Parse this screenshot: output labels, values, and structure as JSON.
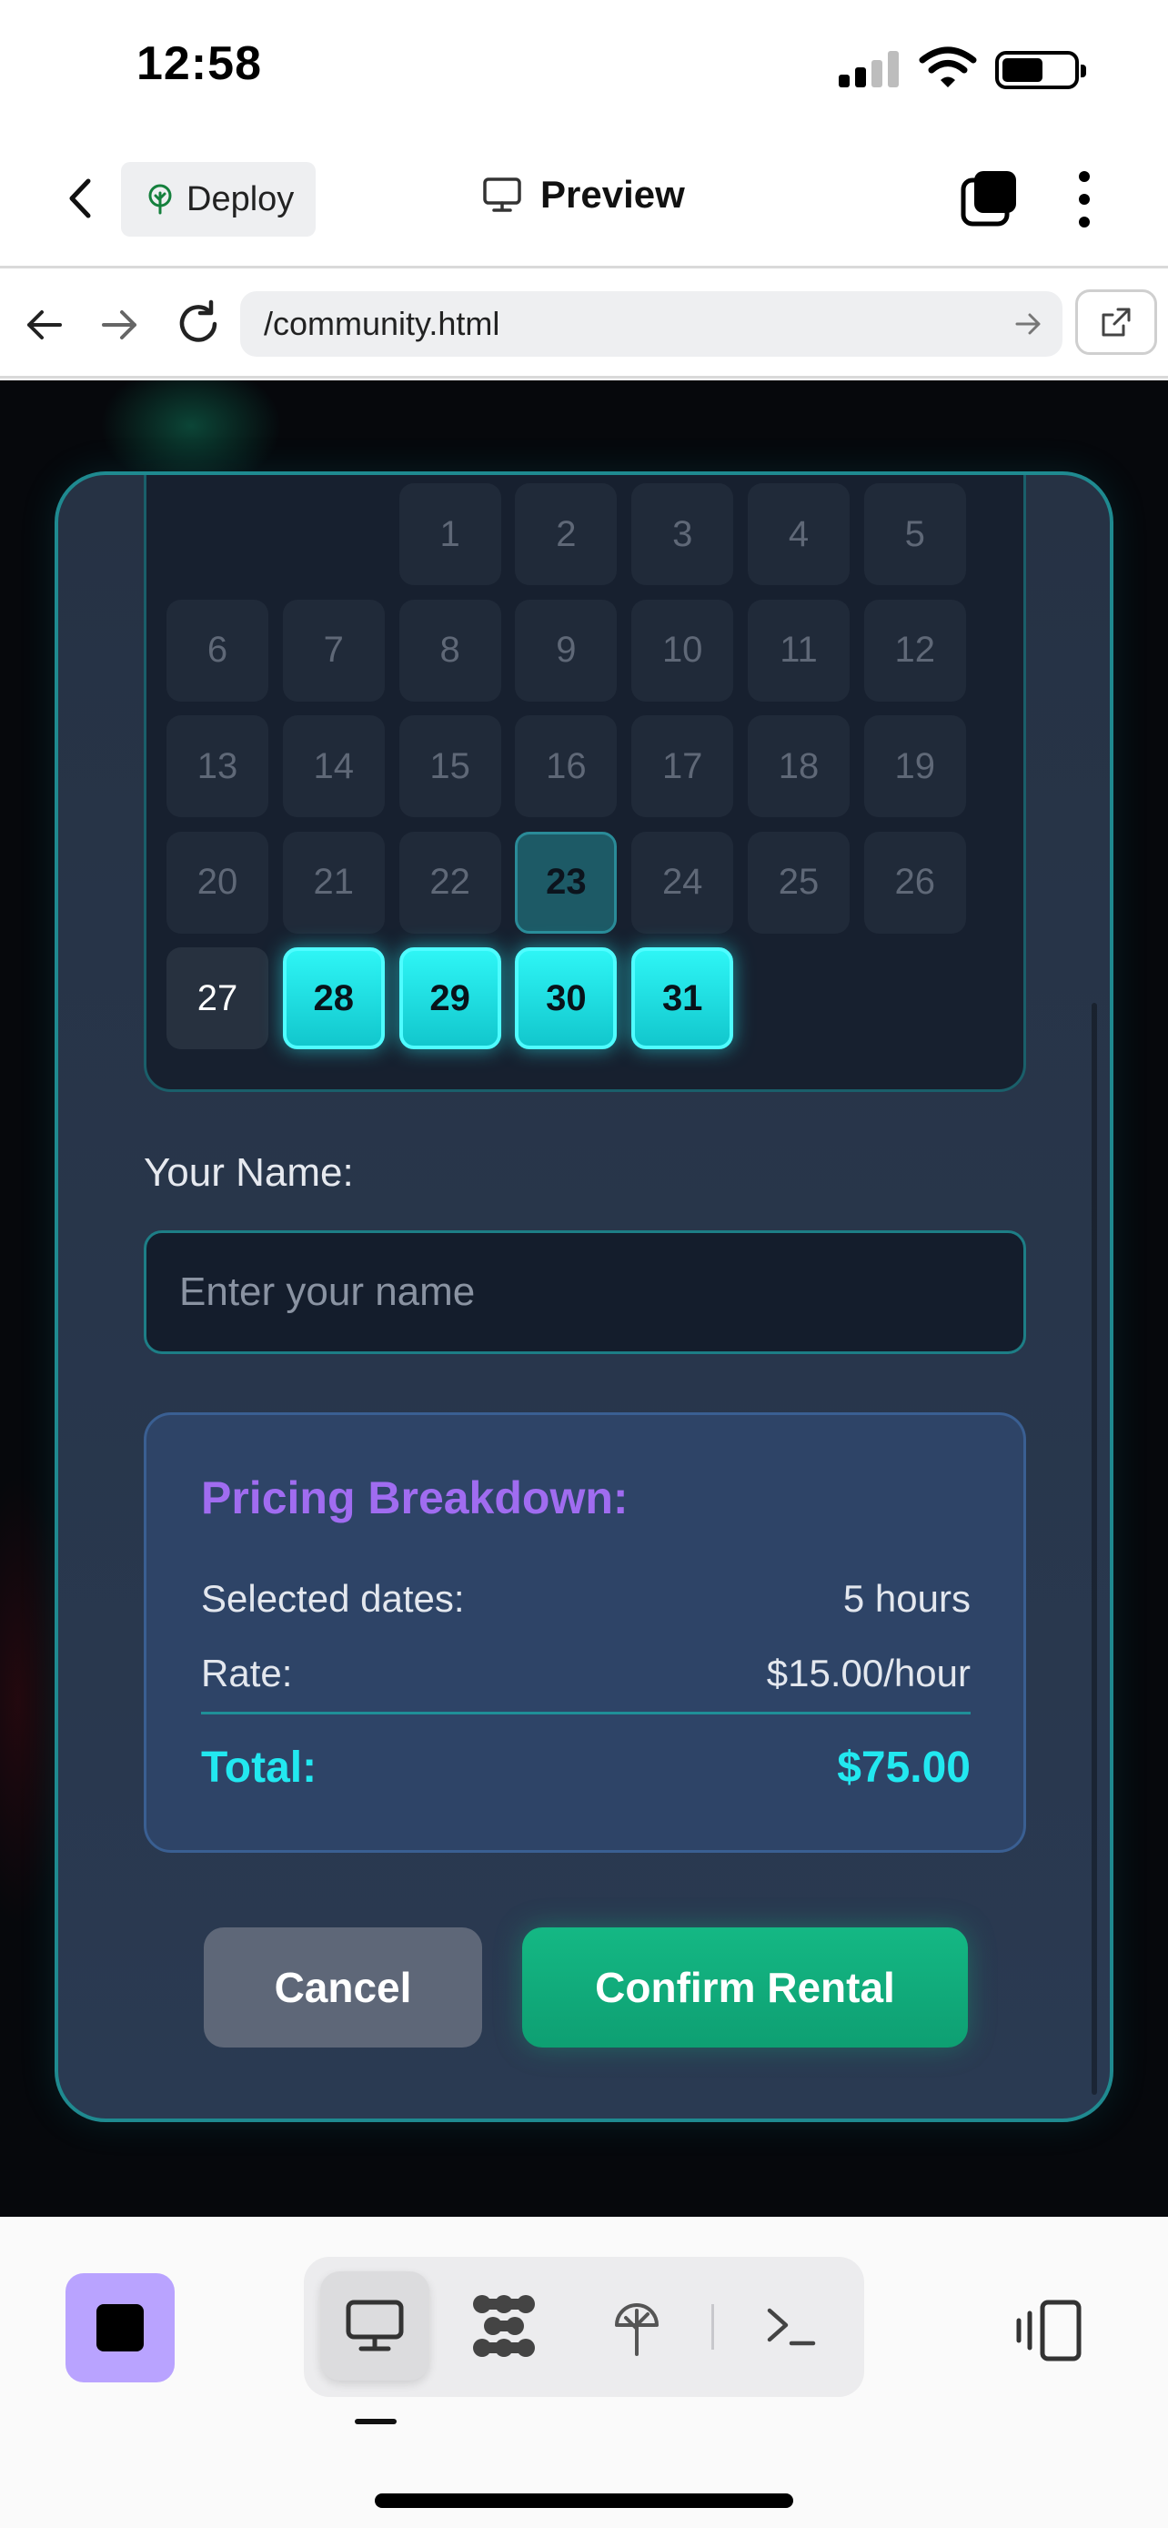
{
  "status_bar": {
    "time": "12:58"
  },
  "header": {
    "back_label": "",
    "deploy_label": "Deploy",
    "title": "Preview"
  },
  "url_bar": {
    "url": "/community.html"
  },
  "calendar": {
    "days": [
      {
        "n": "1"
      },
      {
        "n": "2"
      },
      {
        "n": "3"
      },
      {
        "n": "4"
      },
      {
        "n": "5"
      },
      {
        "n": "6"
      },
      {
        "n": "7"
      },
      {
        "n": "8"
      },
      {
        "n": "9"
      },
      {
        "n": "10"
      },
      {
        "n": "11"
      },
      {
        "n": "12"
      },
      {
        "n": "13"
      },
      {
        "n": "14"
      },
      {
        "n": "15"
      },
      {
        "n": "16"
      },
      {
        "n": "17"
      },
      {
        "n": "18"
      },
      {
        "n": "19"
      },
      {
        "n": "20"
      },
      {
        "n": "21"
      },
      {
        "n": "22"
      },
      {
        "n": "23"
      },
      {
        "n": "24"
      },
      {
        "n": "25"
      },
      {
        "n": "26"
      },
      {
        "n": "27"
      },
      {
        "n": "28"
      },
      {
        "n": "29"
      },
      {
        "n": "30"
      },
      {
        "n": "31"
      }
    ],
    "today": "27",
    "range_marker": "23",
    "selected": [
      "28",
      "29",
      "30",
      "31"
    ]
  },
  "form": {
    "name_label": "Your Name:",
    "name_placeholder": "Enter your name",
    "name_value": ""
  },
  "pricing": {
    "title": "Pricing Breakdown:",
    "selected_label": "Selected dates:",
    "selected_value": "5 hours",
    "rate_label": "Rate:",
    "rate_value": "$15.00/hour",
    "total_label": "Total:",
    "total_value": "$75.00"
  },
  "actions": {
    "cancel_label": "Cancel",
    "confirm_label": "Confirm Rental"
  },
  "colors": {
    "accent_cyan": "#22e8f0",
    "accent_purple": "#a06cf0",
    "confirm_green": "#14b884",
    "modal_border": "#1f8a90",
    "stop_button": "#b9a3ff"
  },
  "icons": {
    "back": "chevron-left-icon",
    "deploy": "tree-icon",
    "preview": "monitor-icon",
    "tabs": "stacked-squares-icon",
    "more": "vertical-dots-icon",
    "nav_back": "arrow-left-icon",
    "nav_forward": "arrow-right-icon",
    "reload": "reload-icon",
    "go": "arrow-right-icon",
    "external": "external-link-icon",
    "stop": "stop-icon",
    "preview_tool": "monitor-icon",
    "components_tool": "component-grid-icon",
    "deploy_tool": "tree-icon",
    "terminal_tool": "terminal-icon",
    "device": "device-rotate-icon"
  }
}
